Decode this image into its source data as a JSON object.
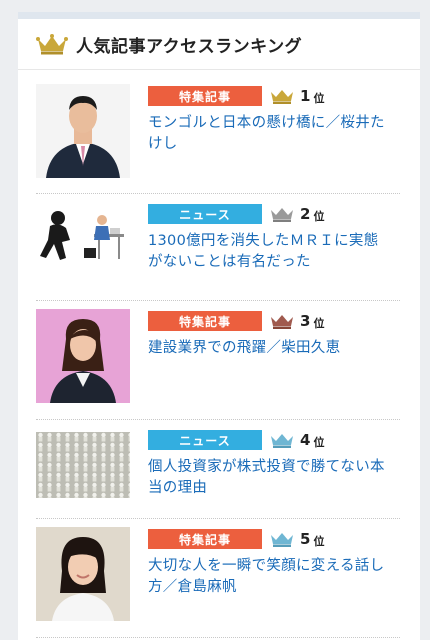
{
  "header": {
    "title": "人気記事アクセスランキング",
    "icon": "gold-crown-icon"
  },
  "colors": {
    "feature_tag": "#ec5f3e",
    "news_tag": "#33aee0",
    "gold": "#c9a73a",
    "silver": "#9a9a9a",
    "bronze": "#a05a4e",
    "blue_crown": "#6fb6d3",
    "link": "#1a6bb8"
  },
  "items": [
    {
      "tag": "特集記事",
      "tag_type": "feature",
      "rank": "1",
      "rank_suffix": "位",
      "crown": "gold",
      "title": "モンゴルと日本の懸け橋に／桜井たけし"
    },
    {
      "tag": "ニュース",
      "tag_type": "news",
      "rank": "2",
      "rank_suffix": "位",
      "crown": "silver",
      "title": "1300億円を消失したＭＲＩに実態がないことは有名だった"
    },
    {
      "tag": "特集記事",
      "tag_type": "feature",
      "rank": "3",
      "rank_suffix": "位",
      "crown": "bronze",
      "title": "建設業界での飛躍／柴田久恵"
    },
    {
      "tag": "ニュース",
      "tag_type": "news",
      "rank": "4",
      "rank_suffix": "位",
      "crown": "blue",
      "title": "個人投資家が株式投資で勝てない本当の理由"
    },
    {
      "tag": "特集記事",
      "tag_type": "feature",
      "rank": "5",
      "rank_suffix": "位",
      "crown": "blue",
      "title": "大切な人を一瞬で笑顔に変える話し方／倉島麻帆"
    }
  ]
}
